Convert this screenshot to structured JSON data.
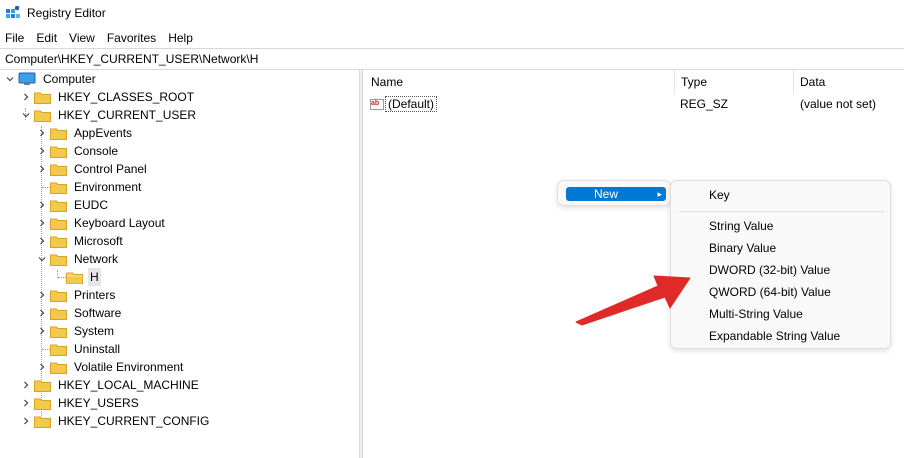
{
  "window": {
    "title": "Registry Editor"
  },
  "menu": [
    "File",
    "Edit",
    "View",
    "Favorites",
    "Help"
  ],
  "address": "Computer\\HKEY_CURRENT_USER\\Network\\H",
  "tree": {
    "root": "Computer",
    "hives": {
      "classes_root": "HKEY_CLASSES_ROOT",
      "current_user": "HKEY_CURRENT_USER",
      "local_machine": "HKEY_LOCAL_MACHINE",
      "users": "HKEY_USERS",
      "current_config": "HKEY_CURRENT_CONFIG"
    },
    "hkcu_children": [
      "AppEvents",
      "Console",
      "Control Panel",
      "Environment",
      "EUDC",
      "Keyboard Layout",
      "Microsoft",
      "Network"
    ],
    "network_child": "H",
    "hkcu_children_after": [
      "Printers",
      "Software",
      "System",
      "Uninstall",
      "Volatile Environment"
    ]
  },
  "list": {
    "columns": {
      "name": "Name",
      "type": "Type",
      "data": "Data"
    },
    "rows": [
      {
        "name": "(Default)",
        "type": "REG_SZ",
        "data": "(value not set)"
      }
    ]
  },
  "context_menu": {
    "new_label": "New",
    "submenu": [
      "Key",
      "String Value",
      "Binary Value",
      "DWORD (32-bit) Value",
      "QWORD (64-bit) Value",
      "Multi-String Value",
      "Expandable String Value"
    ]
  },
  "colors": {
    "accent": "#0078d4",
    "folder": "#f2c94c",
    "annotation_arrow": "#e02a2a",
    "selection": "#e5e5e5"
  }
}
